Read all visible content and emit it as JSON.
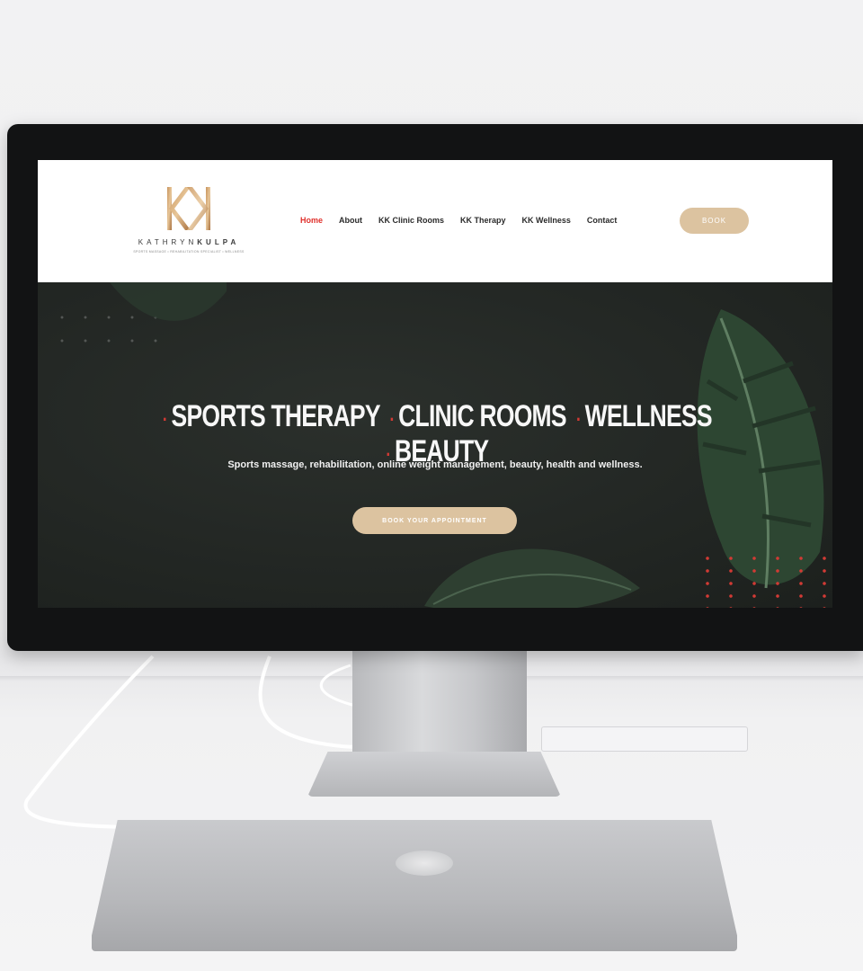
{
  "logo": {
    "name_light": "KATHRYN",
    "name_bold": "KULPA",
    "tagline": "SPORTS MASSAGE • REHABILITATION SPECIALIST • WELLNESS"
  },
  "nav": {
    "items": [
      "Home",
      "About",
      "KK Clinic Rooms",
      "KK Therapy",
      "KK Wellness",
      "Contact"
    ],
    "active": "Home",
    "book_label": "BOOK"
  },
  "hero": {
    "title_parts": [
      "SPORTS THERAPY",
      "CLINIC ROOMS",
      "WELLNESS",
      "BEAUTY"
    ],
    "subtitle": "Sports massage, rehabilitation, online weight management, beauty, health and wellness.",
    "cta_label": "BOOK YOUR APPOINTMENT"
  },
  "colors": {
    "accent_gold": "#dcc3a0",
    "active_red": "#e0312c",
    "hero_bg": "#232724"
  }
}
